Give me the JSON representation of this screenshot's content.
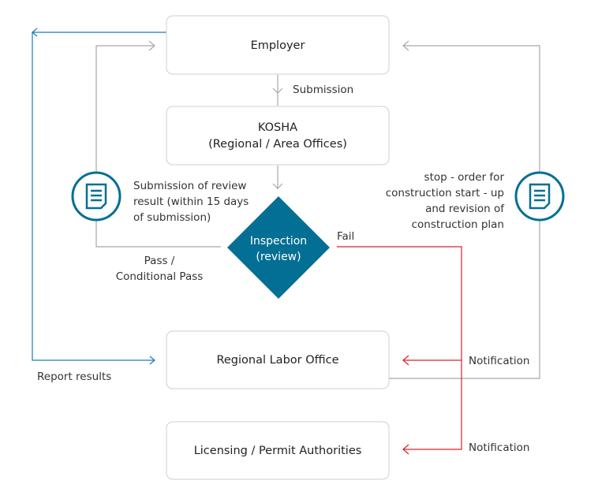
{
  "colors": {
    "diamond": "#046f94",
    "icon": "#046f94",
    "report_line": "#1a7db5",
    "fail_line": "#e0202a",
    "flow_line": "#a8a8a8"
  },
  "nodes": {
    "employer": "Employer",
    "kosha_line1": "KOSHA",
    "kosha_line2": "(Regional / Area Offices)",
    "inspection_line1": "Inspection",
    "inspection_line2": "(review)",
    "regional_labor": "Regional Labor Office",
    "licensing": "Licensing / Permit Authorities"
  },
  "labels": {
    "submission": "Submission",
    "review_result": [
      "Submission of review",
      "result (within 15 days",
      "of submission)"
    ],
    "pass": [
      "Pass /",
      "Conditional Pass"
    ],
    "fail": "Fail",
    "stop_order": [
      "stop - order for",
      "construction start - up",
      "and revision of",
      "construction plan"
    ],
    "notification_1": "Notification",
    "notification_2": "Notification",
    "report_results": "Report results"
  },
  "icons": {
    "left": "document-icon",
    "right": "document-icon"
  }
}
